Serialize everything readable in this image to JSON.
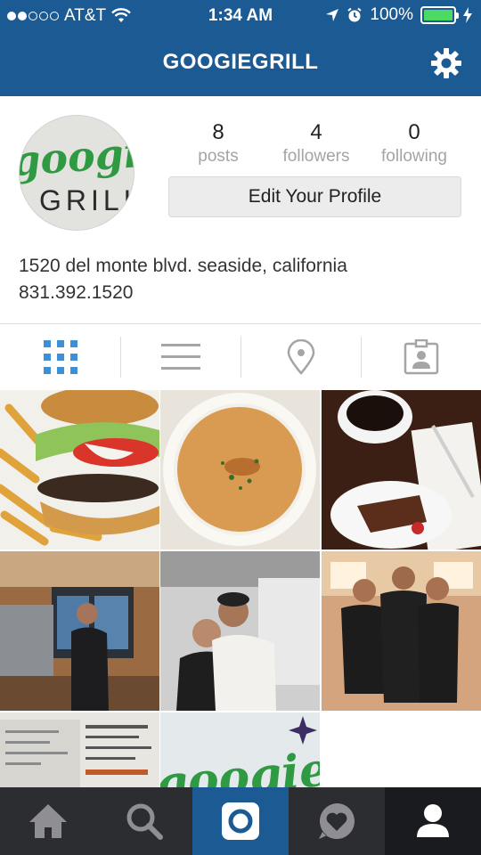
{
  "status_bar": {
    "carrier": "AT&T",
    "time": "1:34 AM",
    "battery": "100%",
    "signal_bars_filled": 2,
    "signal_bars_total": 5
  },
  "header": {
    "title": "GOOGIEGRILL",
    "settings_icon": "gear-icon"
  },
  "profile": {
    "avatar_text_top": "googie",
    "avatar_text_bottom": "GRILL",
    "stats": [
      {
        "value": "8",
        "label": "posts"
      },
      {
        "value": "4",
        "label": "followers"
      },
      {
        "value": "0",
        "label": "following"
      }
    ],
    "edit_button": "Edit Your Profile",
    "bio_line1": "1520 del monte blvd. seaside, california",
    "bio_line2": "831.392.1520"
  },
  "view_tabs": [
    {
      "icon": "grid-icon",
      "active": true
    },
    {
      "icon": "list-icon",
      "active": false
    },
    {
      "icon": "location-pin-icon",
      "active": false
    },
    {
      "icon": "tagged-photos-icon",
      "active": false
    }
  ],
  "photos": [
    {
      "subject": "burger-and-fries"
    },
    {
      "subject": "soup-bowl"
    },
    {
      "subject": "coffee-and-dessert"
    },
    {
      "subject": "barista-at-counter"
    },
    {
      "subject": "two-staff-in-kitchen"
    },
    {
      "subject": "three-staff-posing"
    },
    {
      "subject": "menu-board"
    },
    {
      "subject": "googie-sign"
    }
  ],
  "bottom_nav": [
    {
      "icon": "home-icon"
    },
    {
      "icon": "search-icon"
    },
    {
      "icon": "camera-icon",
      "active": true
    },
    {
      "icon": "activity-heart-icon"
    },
    {
      "icon": "profile-icon",
      "active": true
    }
  ],
  "colors": {
    "brand_blue": "#1b5a93",
    "accent_blue": "#3e8fd6",
    "battery_green": "#4cd964",
    "nav_bg": "#2b2d31"
  }
}
